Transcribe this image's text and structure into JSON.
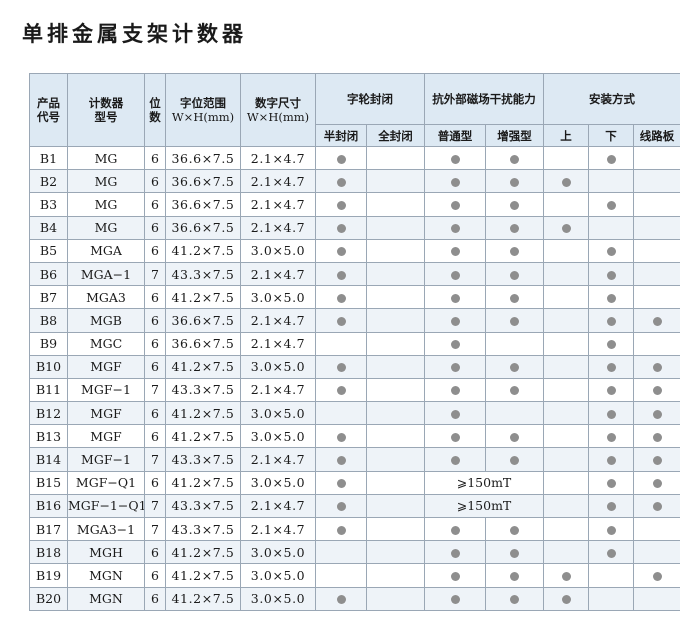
{
  "title": "单排金属支架计数器",
  "dot_color": "#8e8e8e",
  "header": {
    "code": "产品\n代号",
    "model": "计数器\n型号",
    "digits": "位\n数",
    "char_range": "字位范围",
    "char_range_unit": "W×H(mm)",
    "digit_size": "数字尺寸",
    "digit_size_unit": "W×H(mm)",
    "wheel_seal": "字轮封闭",
    "half_seal": "半封闭",
    "full_seal": "全封闭",
    "magnetic": "抗外部磁场干扰能力",
    "normal": "普通型",
    "enhanced": "增强型",
    "mount": "安装方式",
    "top": "上",
    "bottom": "下",
    "pcb": "线路板"
  },
  "rows": [
    {
      "code": "B1",
      "model": "MG",
      "digits": "6",
      "range": "36.6×7.5",
      "size": "2.1×4.7",
      "half": true,
      "full": false,
      "normal": true,
      "enh": true,
      "mag_text": "",
      "top": false,
      "bottom": true,
      "pcb": false
    },
    {
      "code": "B2",
      "model": "MG",
      "digits": "6",
      "range": "36.6×7.5",
      "size": "2.1×4.7",
      "half": true,
      "full": false,
      "normal": true,
      "enh": true,
      "mag_text": "",
      "top": true,
      "bottom": false,
      "pcb": false
    },
    {
      "code": "B3",
      "model": "MG",
      "digits": "6",
      "range": "36.6×7.5",
      "size": "2.1×4.7",
      "half": true,
      "full": false,
      "normal": true,
      "enh": true,
      "mag_text": "",
      "top": false,
      "bottom": true,
      "pcb": false
    },
    {
      "code": "B4",
      "model": "MG",
      "digits": "6",
      "range": "36.6×7.5",
      "size": "2.1×4.7",
      "half": true,
      "full": false,
      "normal": true,
      "enh": true,
      "mag_text": "",
      "top": true,
      "bottom": false,
      "pcb": false
    },
    {
      "code": "B5",
      "model": "MGA",
      "digits": "6",
      "range": "41.2×7.5",
      "size": "3.0×5.0",
      "half": true,
      "full": false,
      "normal": true,
      "enh": true,
      "mag_text": "",
      "top": false,
      "bottom": true,
      "pcb": false
    },
    {
      "code": "B6",
      "model": "MGA−1",
      "digits": "7",
      "range": "43.3×7.5",
      "size": "2.1×4.7",
      "half": true,
      "full": false,
      "normal": true,
      "enh": true,
      "mag_text": "",
      "top": false,
      "bottom": true,
      "pcb": false
    },
    {
      "code": "B7",
      "model": "MGA3",
      "digits": "6",
      "range": "41.2×7.5",
      "size": "3.0×5.0",
      "half": true,
      "full": false,
      "normal": true,
      "enh": true,
      "mag_text": "",
      "top": false,
      "bottom": true,
      "pcb": false
    },
    {
      "code": "B8",
      "model": "MGB",
      "digits": "6",
      "range": "36.6×7.5",
      "size": "2.1×4.7",
      "half": true,
      "full": false,
      "normal": true,
      "enh": true,
      "mag_text": "",
      "top": false,
      "bottom": true,
      "pcb": true
    },
    {
      "code": "B9",
      "model": "MGC",
      "digits": "6",
      "range": "36.6×7.5",
      "size": "2.1×4.7",
      "half": false,
      "full": false,
      "normal": true,
      "enh": false,
      "mag_text": "",
      "top": false,
      "bottom": true,
      "pcb": false
    },
    {
      "code": "B10",
      "model": "MGF",
      "digits": "6",
      "range": "41.2×7.5",
      "size": "3.0×5.0",
      "half": true,
      "full": false,
      "normal": true,
      "enh": true,
      "mag_text": "",
      "top": false,
      "bottom": true,
      "pcb": true
    },
    {
      "code": "B11",
      "model": "MGF−1",
      "digits": "7",
      "range": "43.3×7.5",
      "size": "2.1×4.7",
      "half": true,
      "full": false,
      "normal": true,
      "enh": true,
      "mag_text": "",
      "top": false,
      "bottom": true,
      "pcb": true
    },
    {
      "code": "B12",
      "model": "MGF",
      "digits": "6",
      "range": "41.2×7.5",
      "size": "3.0×5.0",
      "half": false,
      "full": false,
      "normal": true,
      "enh": false,
      "mag_text": "",
      "top": false,
      "bottom": true,
      "pcb": true
    },
    {
      "code": "B13",
      "model": "MGF",
      "digits": "6",
      "range": "41.2×7.5",
      "size": "3.0×5.0",
      "half": true,
      "full": false,
      "normal": true,
      "enh": true,
      "mag_text": "",
      "top": false,
      "bottom": true,
      "pcb": true
    },
    {
      "code": "B14",
      "model": "MGF−1",
      "digits": "7",
      "range": "43.3×7.5",
      "size": "2.1×4.7",
      "half": true,
      "full": false,
      "normal": true,
      "enh": true,
      "mag_text": "",
      "top": false,
      "bottom": true,
      "pcb": true
    },
    {
      "code": "B15",
      "model": "MGF−Q1",
      "digits": "6",
      "range": "41.2×7.5",
      "size": "3.0×5.0",
      "half": true,
      "full": false,
      "normal": false,
      "enh": false,
      "mag_text": "⩾150mT",
      "top": false,
      "bottom": true,
      "pcb": true
    },
    {
      "code": "B16",
      "model": "MGF−1−Q1",
      "digits": "7",
      "range": "43.3×7.5",
      "size": "2.1×4.7",
      "half": true,
      "full": false,
      "normal": false,
      "enh": false,
      "mag_text": "⩾150mT",
      "top": false,
      "bottom": true,
      "pcb": true
    },
    {
      "code": "B17",
      "model": "MGA3−1",
      "digits": "7",
      "range": "43.3×7.5",
      "size": "2.1×4.7",
      "half": true,
      "full": false,
      "normal": true,
      "enh": true,
      "mag_text": "",
      "top": false,
      "bottom": true,
      "pcb": false
    },
    {
      "code": "B18",
      "model": "MGH",
      "digits": "6",
      "range": "41.2×7.5",
      "size": "3.0×5.0",
      "half": false,
      "full": false,
      "normal": true,
      "enh": true,
      "mag_text": "",
      "top": false,
      "bottom": true,
      "pcb": false
    },
    {
      "code": "B19",
      "model": "MGN",
      "digits": "6",
      "range": "41.2×7.5",
      "size": "3.0×5.0",
      "half": false,
      "full": false,
      "normal": true,
      "enh": true,
      "mag_text": "",
      "top": true,
      "bottom": false,
      "pcb": true
    },
    {
      "code": "B20",
      "model": "MGN",
      "digits": "6",
      "range": "41.2×7.5",
      "size": "3.0×5.0",
      "half": true,
      "full": false,
      "normal": true,
      "enh": true,
      "mag_text": "",
      "top": true,
      "bottom": false,
      "pcb": false
    }
  ]
}
